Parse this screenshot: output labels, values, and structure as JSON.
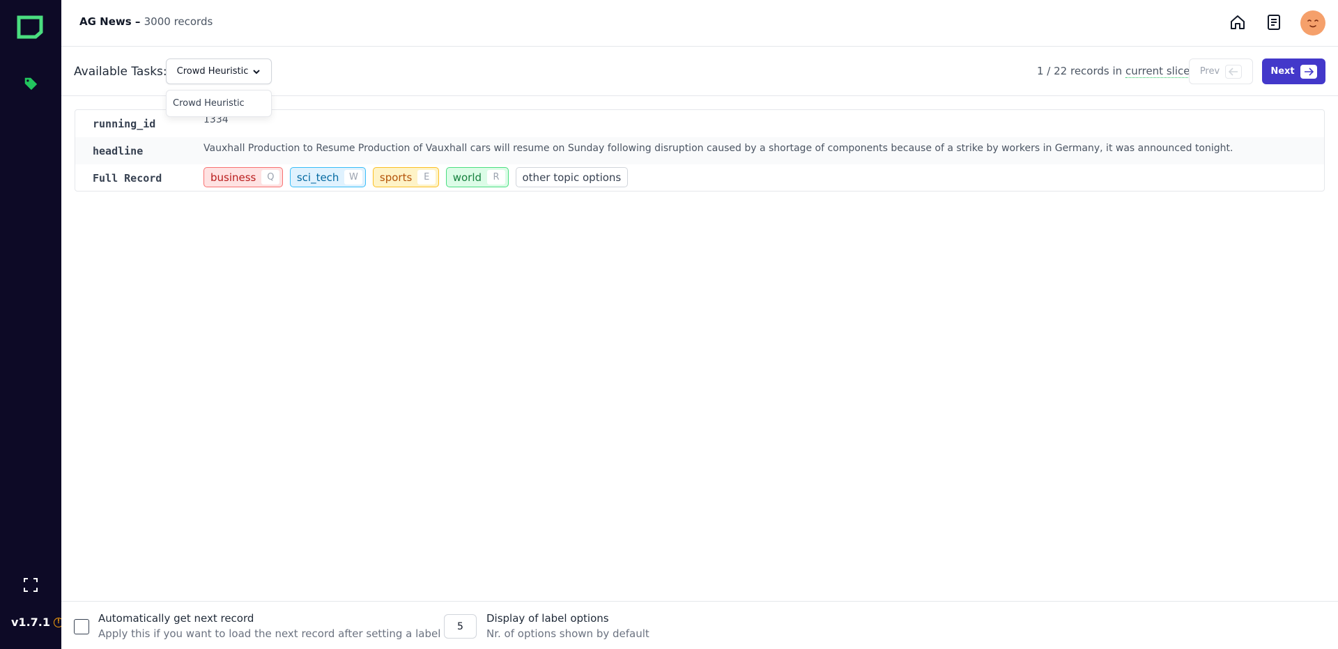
{
  "app": {
    "version": "v1.7.1",
    "brand_color": "#0d0a26",
    "accent_color": "#4338ca"
  },
  "sidebar": {
    "items": [
      {
        "icon": "tag-icon",
        "color": "#22c55e"
      }
    ]
  },
  "header": {
    "project_name": "AG News –",
    "record_count": "3000 records",
    "icons": [
      "home-icon",
      "document-icon",
      "avatar"
    ]
  },
  "toolbar": {
    "tasks_label": "Available Tasks:",
    "selected_task": "Crowd Heuristic",
    "task_options": [
      "Crowd Heuristic"
    ],
    "records_position": "1 / 22 records in",
    "slice_label": "current slice",
    "prev_label": "Prev",
    "next_label": "Next"
  },
  "record": {
    "fields": [
      {
        "key": "running_id",
        "value": "1334"
      },
      {
        "key": "headline",
        "value": "Vauxhall Production to Resume Production of Vauxhall cars will resume on Sunday following disruption caused by a shortage of components because of a strike by workers in Germany, it was announced tonight."
      },
      {
        "key": "Full Record"
      }
    ],
    "labels": [
      {
        "name": "business",
        "shortcut": "Q",
        "color": "#f87171"
      },
      {
        "name": "sci_tech",
        "shortcut": "W",
        "color": "#38bdf8"
      },
      {
        "name": "sports",
        "shortcut": "E",
        "color": "#fbbf24"
      },
      {
        "name": "world",
        "shortcut": "R",
        "color": "#4ade80"
      }
    ],
    "other_options_label": "other topic options"
  },
  "footer": {
    "auto_next_title": "Automatically get next record",
    "auto_next_desc": "Apply this if you want to load the next record after setting a label",
    "label_count_value": "5",
    "display_title": "Display of label options",
    "display_desc": "Nr. of options shown by default"
  }
}
